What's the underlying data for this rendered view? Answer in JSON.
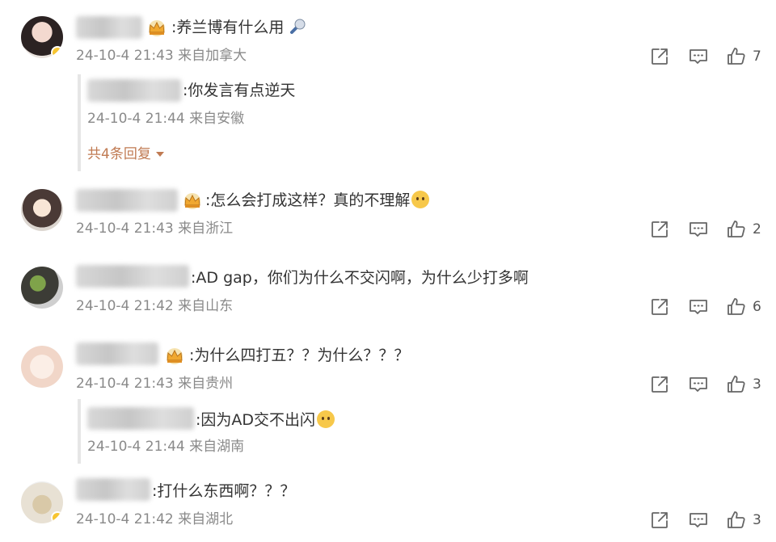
{
  "comments": [
    {
      "text": ":养兰博有什么用",
      "time": "24-10-4 21:43",
      "location": "来自加拿大",
      "likes": "7",
      "replies": [
        {
          "text": ":你发言有点逆天",
          "time": "24-10-4 21:44",
          "location": "来自安徽"
        }
      ],
      "more_replies": "共4条回复"
    },
    {
      "text": ":怎么会打成这样？真的不理解",
      "time": "24-10-4 21:43",
      "location": "来自浙江",
      "likes": "2"
    },
    {
      "text": ":AD gap，你们为什么不交闪啊，为什么少打多啊",
      "time": "24-10-4 21:42",
      "location": "来自山东",
      "likes": "6"
    },
    {
      "text": ":为什么四打五？？为什么？？？",
      "time": "24-10-4 21:43",
      "location": "来自贵州",
      "likes": "3",
      "replies": [
        {
          "text": ":因为AD交不出闪",
          "time": "24-10-4 21:44",
          "location": "来自湖南"
        }
      ]
    },
    {
      "text": ":打什么东西啊？？？",
      "time": "24-10-4 21:42",
      "location": "来自湖北",
      "likes": "3"
    }
  ],
  "icons": {
    "share": "share-icon",
    "comment": "comment-icon",
    "like": "thumbs-up-icon",
    "crown": "crown-icon",
    "verified": "verified-badge-icon"
  },
  "colors": {
    "meta_text": "#8a8a8a",
    "more_replies": "#c07a52",
    "badge": "#f7c531"
  }
}
